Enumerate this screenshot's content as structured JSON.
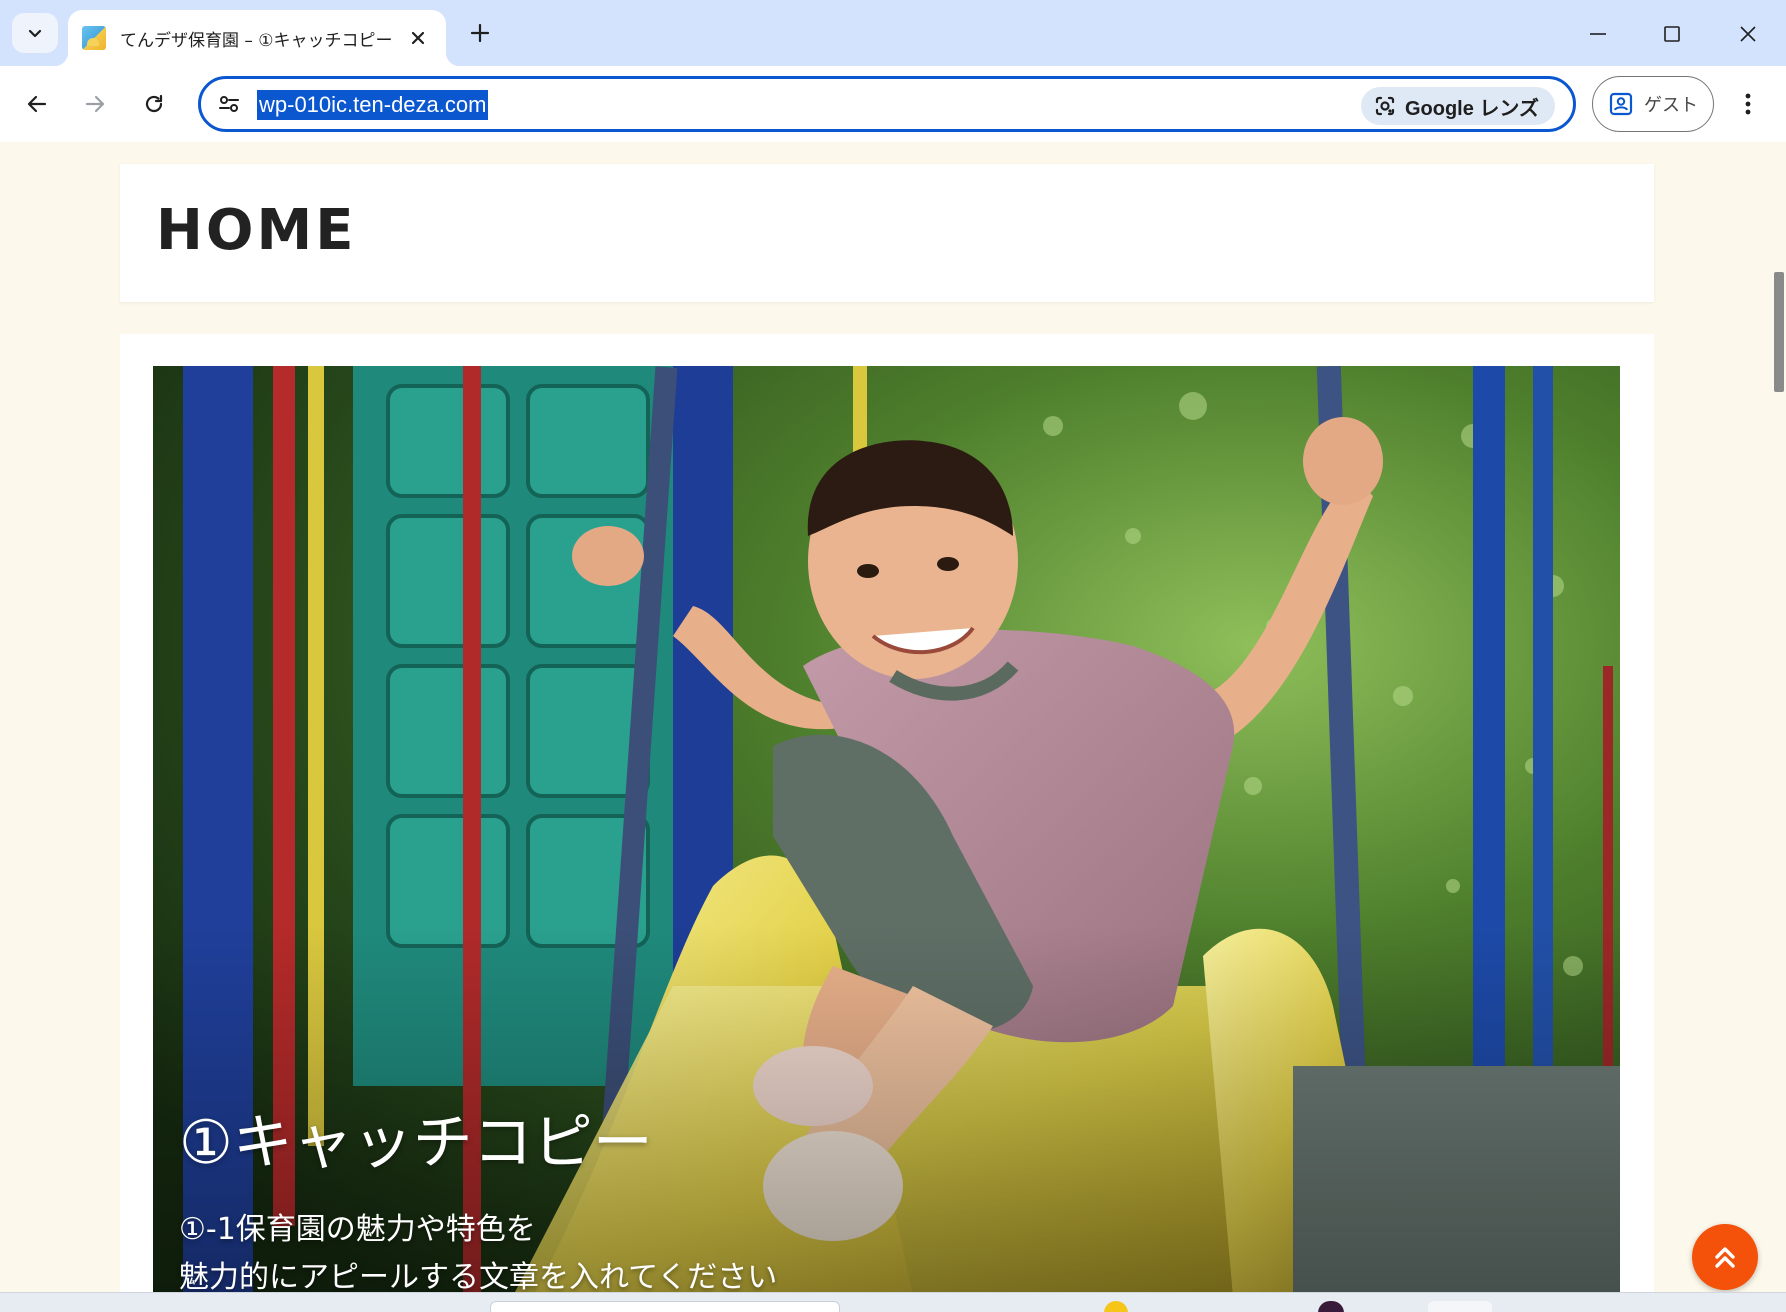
{
  "browser": {
    "tab": {
      "title": "てんデザ保育園 – ①キャッチコピー",
      "favicon": "site-favicon"
    },
    "omnibox": {
      "url": "wp-010ic.ten-deza.com",
      "lens_label": "Google レンズ"
    },
    "profile": {
      "label": "ゲスト"
    },
    "accent_color": "#0b57d0"
  },
  "page": {
    "home_title": "HOME",
    "hero": {
      "heading": "①キャッチコピー",
      "subtext_line1": "①-1保育園の魅力や特色を",
      "subtext_line2": "魅力的にアピールする文章を入れてください"
    },
    "to_top_color": "#f4510a",
    "background_color": "#fdf8ec"
  }
}
